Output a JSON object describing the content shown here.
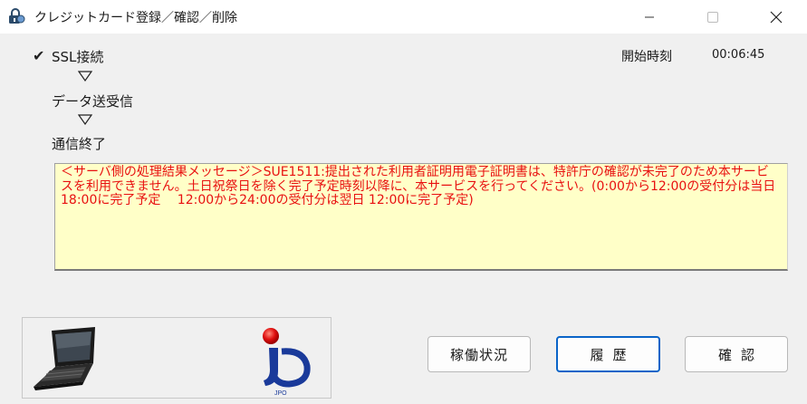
{
  "window": {
    "title": "クレジットカード登録／確認／削除",
    "app_icon": "lock-icon",
    "controls": [
      "minimize-icon",
      "maximize-icon",
      "close-icon"
    ]
  },
  "steps": {
    "check_mark": "✔",
    "items": [
      "SSL接続",
      "データ送受信",
      "通信終了"
    ],
    "arrow_icon": "down-triangle-icon"
  },
  "start": {
    "label": "開始時刻",
    "time": "00:06:45"
  },
  "message": {
    "text": "＜サーバ側の処理結果メッセージ＞SUE1511:提出された利用者証明用電子証明書は、特許庁の確認が未完了のため本サービスを利用できません。土日祝祭日を除く完了予定時刻以降に、本サービスを行ってください。(0:00から12:00の受付分は当日 18:00に完了予定　 12:00から24:00の受付分は翌日 12:00に完了予定)",
    "color": "#e81010",
    "background": "#ffffc8"
  },
  "logos": {
    "left_image": "laptop-icon",
    "right_image": "jpo-logo",
    "jpo_text": "JPO"
  },
  "buttons": {
    "status_label": "稼働状況",
    "history_label": "履歴",
    "confirm_label": "確認"
  }
}
